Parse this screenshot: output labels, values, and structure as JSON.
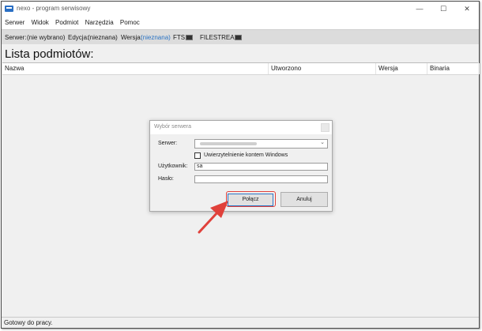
{
  "window": {
    "title": "nexo - program serwisowy",
    "controls": {
      "minimize": "—",
      "maximize": "☐",
      "close": "✕"
    }
  },
  "menu": [
    "Serwer",
    "Widok",
    "Podmiot",
    "Narzędzia",
    "Pomoc"
  ],
  "infobar": {
    "server_label": "Serwer:",
    "server_value": "(nie wybrano)",
    "edition_label": "Edycja:",
    "edition_value": "(nieznana)",
    "version_label": "Wersja:",
    "version_value": "(nieznana)",
    "fts_label": "FTS:",
    "filestream_label": "FILESTREAM:"
  },
  "page_title": "Lista podmiotów:",
  "list": {
    "columns": [
      "Nazwa",
      "Utworzono",
      "Wersja",
      "Binaria"
    ]
  },
  "status": "Gotowy do pracy.",
  "dialog": {
    "title": "Wybór serwera",
    "server_label": "Serwer:",
    "server_value": "",
    "windows_auth_label": "Uwierzytelnienie kontem Windows",
    "windows_auth_checked": false,
    "user_label": "Użytkownik:",
    "user_value": "sa",
    "password_label": "Hasło:",
    "password_value": "",
    "connect_label": "Połącz",
    "cancel_label": "Anuluj"
  },
  "colors": {
    "accent": "#2a73c4",
    "annotation": "#e0413b",
    "infobar_bg": "#dcdcdc"
  }
}
